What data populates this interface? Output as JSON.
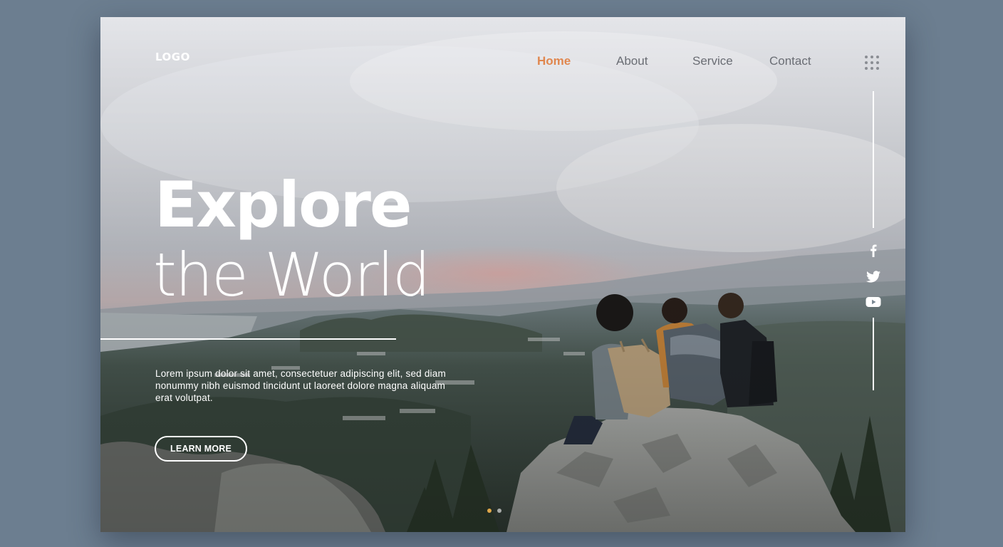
{
  "header": {
    "logo_text": "LOGO",
    "nav": [
      {
        "label": "Home",
        "active": true
      },
      {
        "label": "About",
        "active": false
      },
      {
        "label": "Service",
        "active": false
      },
      {
        "label": "Contact",
        "active": false
      }
    ],
    "menu_icon": "grid-dots-icon"
  },
  "hero": {
    "title_line1": "Explore",
    "title_line2": "the World",
    "description": "Lorem ipsum dolor sit amet, consectetuer adipiscing elit, sed diam nonummy nibh euismod tincidunt ut laoreet dolore magna aliquam erat volutpat.",
    "button_label": "LEARN MORE"
  },
  "social": [
    "facebook-icon",
    "twitter-icon",
    "youtube-icon"
  ],
  "slider": {
    "slides": 2,
    "active_index": 0
  },
  "colors": {
    "accent": "#e0874f",
    "page_background": "#6c7e90",
    "text_light": "#ffffff",
    "nav_text": "#6a6d74"
  }
}
